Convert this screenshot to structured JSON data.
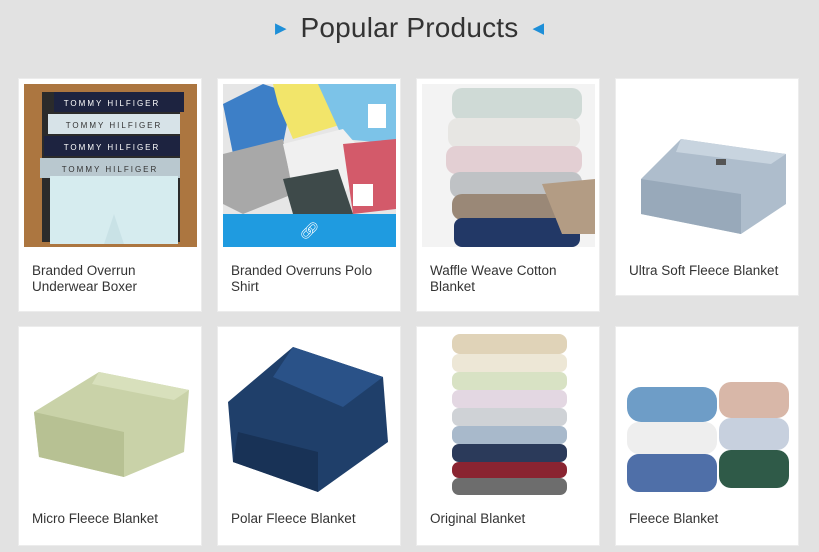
{
  "section": {
    "title": "Popular Products",
    "left_arrow_icon": "triangle-right-icon",
    "right_arrow_icon": "triangle-left-icon",
    "accent_color": "#1f9be0"
  },
  "products": [
    {
      "name": "Branded Overrun Underwear Boxer",
      "image": "boxer-briefs"
    },
    {
      "name": "Branded Overruns Polo Shirt",
      "image": "polo-shirts",
      "hover_icon": "link-icon"
    },
    {
      "name": "Waffle Weave Cotton Blanket",
      "image": "waffle-blankets"
    },
    {
      "name": "Ultra Soft Fleece Blanket",
      "image": "folded-blue-fleece"
    },
    {
      "name": "Micro Fleece Blanket",
      "image": "folded-green-fleece"
    },
    {
      "name": "Polar Fleece Blanket",
      "image": "folded-navy-fleece"
    },
    {
      "name": "Original Blanket",
      "image": "stacked-blankets"
    },
    {
      "name": "Fleece Blanket",
      "image": "fleece-blanket-stacks"
    }
  ]
}
